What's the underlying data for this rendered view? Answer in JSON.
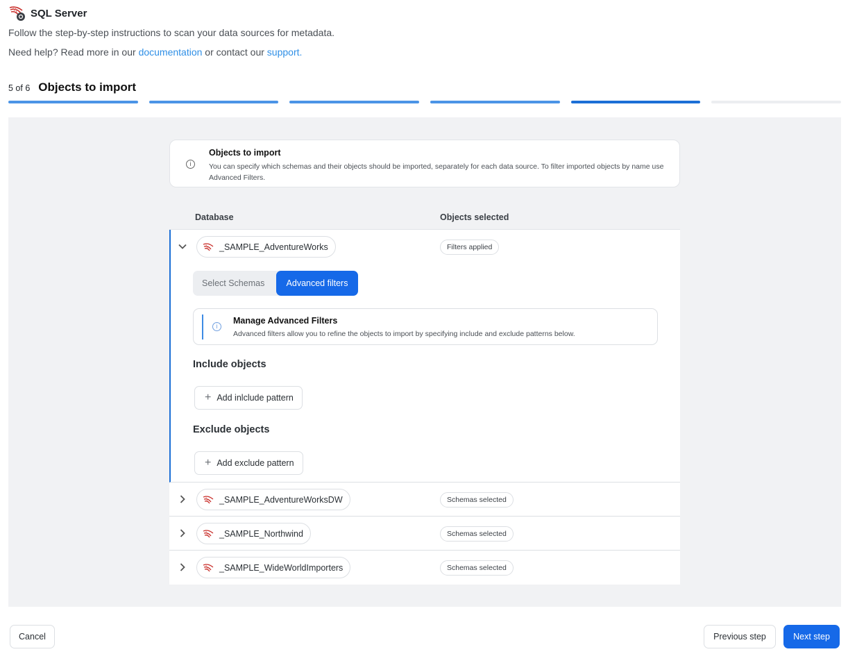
{
  "header": {
    "app_title": "SQL Server",
    "subtitle": "Follow the step-by-step instructions to scan your data sources for metadata.",
    "help_prefix": "Need help? Read more in our",
    "help_link_docs": "documentation",
    "help_middle": "or contact our",
    "help_link_support": "support."
  },
  "step": {
    "count": "5 of 6",
    "title": "Objects to import",
    "total": 6,
    "current": 5
  },
  "info_card": {
    "icon": "info-icon",
    "title": "Objects to import",
    "text": "You can specify which schemas and their objects should be imported, separately for each data source. To filter imported objects by name use Advanced Filters."
  },
  "table": {
    "col_database": "Database",
    "col_objects": "Objects selected",
    "rows": [
      {
        "name": "_SAMPLE_AdventureWorks",
        "status": "Filters applied",
        "expanded": true
      },
      {
        "name": "_SAMPLE_AdventureWorksDW",
        "status": "Schemas selected",
        "expanded": false
      },
      {
        "name": "_SAMPLE_Northwind",
        "status": "Schemas selected",
        "expanded": false
      },
      {
        "name": "_SAMPLE_WideWorldImporters",
        "status": "Schemas selected",
        "expanded": false
      }
    ]
  },
  "expanded": {
    "tab_schemas": "Select Schemas",
    "tab_advanced": "Advanced filters",
    "active_tab": "Advanced filters",
    "adv_title": "Manage Advanced Filters",
    "adv_text": "Advanced filters allow you to refine the objects to import by specifying include and exclude patterns below.",
    "include_heading": "Include objects",
    "include_button": "Add inlclude pattern",
    "exclude_heading": "Exclude objects",
    "exclude_button": "Add exclude pattern"
  },
  "footer": {
    "cancel": "Cancel",
    "previous": "Previous step",
    "next": "Next step"
  },
  "colors": {
    "accent": "#1669e8",
    "link": "#2f8fe6",
    "progress_done": "#4b94e6",
    "progress_current": "#1c6fd6",
    "panel_bg": "#f1f2f4"
  }
}
